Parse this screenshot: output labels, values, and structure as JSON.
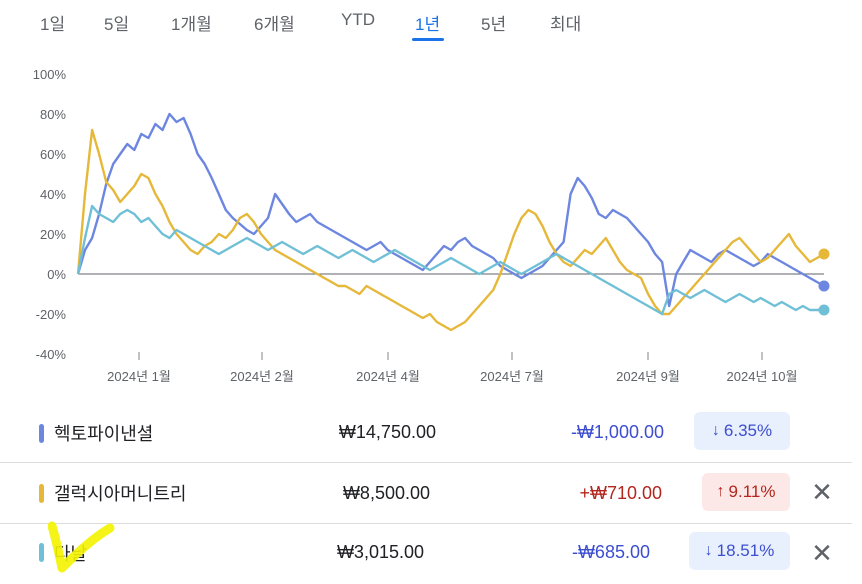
{
  "range_tabs": [
    {
      "label": "1일"
    },
    {
      "label": "5일"
    },
    {
      "label": "1개월"
    },
    {
      "label": "6개월"
    },
    {
      "label": "YTD"
    },
    {
      "label": "1년"
    },
    {
      "label": "5년"
    },
    {
      "label": "최대"
    }
  ],
  "active_tab": "1년",
  "colors": {
    "series1": "#6d87e0",
    "series2": "#e6b83a",
    "series3": "#6fc0d6",
    "tab_active": "#1a73e8",
    "down_text": "#3c4ecf",
    "down_bg": "#e8f0fe",
    "up_text": "#b3261e",
    "up_bg": "#fce8e6",
    "highlight": "#f4f300"
  },
  "chart_data": {
    "type": "line",
    "y_unit": "%",
    "ylim": [
      -40,
      100
    ],
    "y_ticks": [
      "100%",
      "80%",
      "60%",
      "40%",
      "20%",
      "0%",
      "-20%",
      "-40%"
    ],
    "x_ticks": [
      "2024년 1월",
      "2024년 2월",
      "2024년 4월",
      "2024년 7월",
      "2024년 9월",
      "2024년 10월"
    ],
    "series": [
      {
        "name": "헥토파이낸셜",
        "values": [
          0,
          12,
          18,
          30,
          45,
          55,
          60,
          65,
          62,
          70,
          68,
          75,
          72,
          80,
          76,
          78,
          70,
          60,
          55,
          48,
          40,
          32,
          28,
          25,
          22,
          20,
          24,
          28,
          40,
          35,
          30,
          26,
          28,
          30,
          26,
          24,
          22,
          20,
          18,
          16,
          14,
          12,
          14,
          16,
          12,
          10,
          8,
          6,
          4,
          2,
          6,
          10,
          14,
          12,
          16,
          18,
          14,
          12,
          10,
          8,
          4,
          2,
          0,
          -2,
          0,
          2,
          4,
          8,
          12,
          16,
          40,
          48,
          44,
          38,
          30,
          28,
          32,
          30,
          28,
          24,
          20,
          16,
          10,
          6,
          -16,
          0,
          6,
          12,
          10,
          8,
          6,
          10,
          12,
          10,
          8,
          6,
          4,
          6,
          10,
          8,
          6,
          4,
          2,
          0,
          -2,
          -4,
          -6
        ]
      },
      {
        "name": "갤럭시아머니트리",
        "values": [
          0,
          40,
          72,
          60,
          46,
          42,
          36,
          40,
          44,
          50,
          48,
          40,
          34,
          26,
          20,
          16,
          12,
          10,
          14,
          16,
          20,
          18,
          22,
          28,
          30,
          26,
          20,
          16,
          12,
          10,
          8,
          6,
          4,
          2,
          0,
          -2,
          -4,
          -6,
          -6,
          -8,
          -10,
          -6,
          -8,
          -10,
          -12,
          -14,
          -16,
          -18,
          -20,
          -22,
          -20,
          -24,
          -26,
          -28,
          -26,
          -24,
          -20,
          -16,
          -12,
          -8,
          0,
          10,
          20,
          28,
          32,
          30,
          24,
          16,
          10,
          6,
          4,
          8,
          12,
          10,
          14,
          18,
          12,
          6,
          2,
          0,
          -2,
          -10,
          -16,
          -20,
          -20,
          -16,
          -12,
          -8,
          -4,
          0,
          4,
          8,
          12,
          16,
          18,
          14,
          10,
          6,
          8,
          12,
          16,
          20,
          14,
          10,
          6,
          8,
          10
        ]
      },
      {
        "name": "다날",
        "values": [
          0,
          18,
          34,
          30,
          28,
          26,
          30,
          32,
          30,
          26,
          28,
          24,
          20,
          18,
          22,
          20,
          18,
          16,
          14,
          12,
          10,
          12,
          14,
          16,
          18,
          16,
          14,
          12,
          14,
          16,
          14,
          12,
          10,
          12,
          14,
          12,
          10,
          8,
          10,
          12,
          10,
          8,
          6,
          8,
          10,
          12,
          10,
          8,
          6,
          4,
          2,
          4,
          6,
          8,
          6,
          4,
          2,
          0,
          2,
          4,
          6,
          4,
          2,
          0,
          2,
          4,
          6,
          8,
          10,
          8,
          6,
          4,
          2,
          0,
          -2,
          -4,
          -6,
          -8,
          -10,
          -12,
          -14,
          -16,
          -18,
          -20,
          -10,
          -8,
          -10,
          -12,
          -10,
          -8,
          -10,
          -12,
          -14,
          -12,
          -10,
          -12,
          -14,
          -12,
          -14,
          -16,
          -14,
          -16,
          -18,
          -16,
          -18,
          -18,
          -18
        ]
      }
    ]
  },
  "stocks": [
    {
      "name": "헥토파이낸셜",
      "price": "₩14,750.00",
      "change": "-₩1,000.00",
      "percent": "6.35%",
      "direction": "down",
      "removable": false
    },
    {
      "name": "갤럭시아머니트리",
      "price": "₩8,500.00",
      "change": "+₩710.00",
      "percent": "9.11%",
      "direction": "up",
      "removable": true
    },
    {
      "name": "다날",
      "price": "₩3,015.00",
      "change": "-₩685.00",
      "percent": "18.51%",
      "direction": "down",
      "removable": true
    }
  ],
  "icons": {
    "arrow_down": "↓",
    "arrow_up": "↑",
    "close": "✕"
  }
}
